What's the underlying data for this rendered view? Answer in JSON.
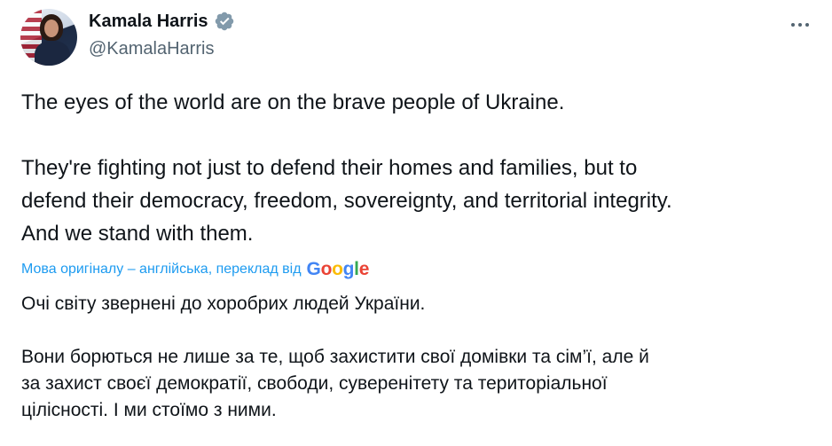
{
  "author": {
    "name": "Kamala Harris",
    "handle": "@KamalaHarris",
    "verified_icon": "verified-badge-icon"
  },
  "menu": {
    "icon": "more-horizontal-icon"
  },
  "tweet": {
    "line1": "The eyes of the world are on the brave people of Ukraine.",
    "line2": "They're fighting not just to defend their homes and families, but to",
    "line3": "defend their democracy, freedom, sovereignty, and territorial integrity.",
    "line4": "And we stand with them."
  },
  "translation": {
    "notice": "Мова оригіналу – англійська, переклад від",
    "provider": "Google",
    "line1": "Очі світу звернені до хоробрих людей України.",
    "line2": "Вони борються не лише за те, щоб захистити свої домівки та сім’ї, але й",
    "line3": "за захист своєї демократії, свободи, суверенітету та територіальної",
    "line4": "цілісності. І ми стоїмо з ними."
  },
  "colors": {
    "link": "#1d9bf0",
    "secondary_text": "#536471",
    "primary_text": "#0f1419"
  }
}
